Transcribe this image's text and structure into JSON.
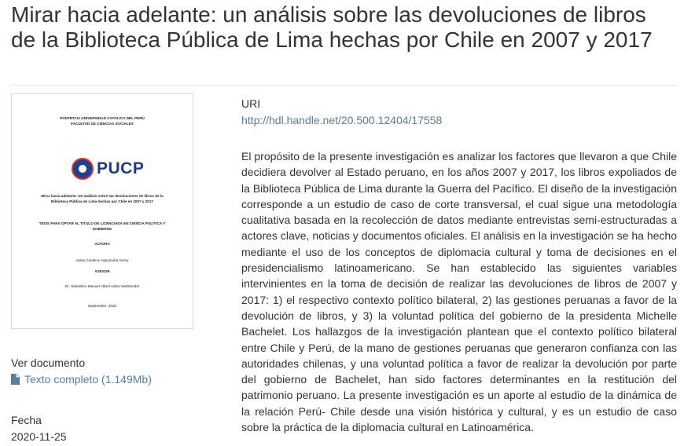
{
  "page": {
    "title": "Mirar hacia adelante: un análisis sobre las devoluciones de libros de la Biblioteca Pública de Lima hechas por Chile en 2007 y 2017"
  },
  "thumbnail": {
    "university": "PONTIFICIA UNIVERSIDAD CATÓLICA DEL PERÚ",
    "faculty": "FACULTAD DE CIENCIAS SOCIALES",
    "logo_text": "PUCP",
    "cover_title_1": "Mirar hacia adelante: Un análisis sobre las devoluciones de libros de la",
    "cover_title_2": "Biblioteca Pública de Lima hechas por Chile en 2007 y 2017",
    "degree_1": "TESIS PARA OPTAR AL TÍTULO DE LICENCIADA EN CIENCIA POLÍTICA Y",
    "degree_2": "GOBIERNO",
    "author_label": "AUTORA",
    "author": "Vania Carolina Aspiazueta Serey",
    "advisor_label": "ASESOR",
    "advisor": "Dr. Sebastien Manuel Albert Adins Vanbrendet",
    "date": "Septiembre, 2020"
  },
  "document": {
    "label": "Ver documento",
    "file_link": "Texto completo (1.149Mb)"
  },
  "date_field": {
    "label": "Fecha",
    "value": "2020-11-25"
  },
  "uri": {
    "label": "URI",
    "link": "http://hdl.handle.net/20.500.12404/17558"
  },
  "abstract": "El propósito de la presente investigación es analizar los factores que llevaron a que Chile decidiera devolver al Estado peruano, en los años 2007 y 2017, los libros expoliados de la Biblioteca Pública de Lima durante la Guerra del Pacífico. El diseño de la investigación corresponde a un estudio de caso de corte transversal, el cual sigue una metodología cualitativa basada en la recolección de datos mediante entrevistas semi-estructuradas a actores clave, noticias y documentos oficiales. El análisis en la investigación se ha hecho mediante el uso de los conceptos de diplomacia cultural y toma de decisiones en el presidencialismo latinoamericano. Se han establecido las siguientes variables intervinientes en la toma de decisión de realizar las devoluciones de libros de 2007 y 2017: 1) el respectivo contexto político bilateral, 2) las gestiones peruanas a favor de la devolución de libros, y 3) la voluntad política del gobierno de la presidenta Michelle Bachelet. Los hallazgos de la investigación plantean que el contexto político bilateral entre Chile y Perú, de la mano de gestiones peruanas que generaron confianza con las autoridades chilenas, y una voluntad política a favor de realizar la devolución por parte del gobierno de Bachelet, han sido factores determinantes en la restitución del patrimonio peruano. La presente investigación es un aporte al estudio de la dinámica de la relación Perú- Chile desde una visión histórica y cultural, y es un estudio de caso sobre la práctica de la diplomacia cultural en Latinoamérica.",
  "icons": {
    "file": "file-icon"
  }
}
